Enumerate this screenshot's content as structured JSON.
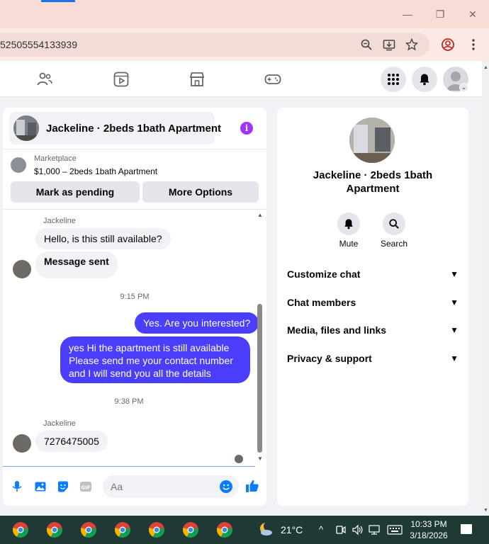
{
  "browser": {
    "url": "52505554133939",
    "window_controls": {
      "minimize": "—",
      "restore": "❐",
      "close": "✕"
    }
  },
  "fb_nav": {
    "icons": [
      "friends-icon",
      "watch-icon",
      "marketplace-icon",
      "gaming-icon"
    ],
    "menu_icon": "grid-icon",
    "notifications_icon": "bell-icon"
  },
  "chat": {
    "title": "Jackeline · 2beds 1bath Apartment",
    "marketplace": {
      "label": "Marketplace",
      "item": "$1,000 – 2beds 1bath Apartment"
    },
    "actions": {
      "mark_pending": "Mark as pending",
      "more_options": "More Options"
    },
    "messages": [
      {
        "sender": "Jackeline",
        "text": "Hello, is this still available?"
      },
      {
        "text": "Message sent"
      },
      {
        "time": "9:15 PM"
      },
      {
        "text": "Yes. Are you interested?"
      },
      {
        "lines": [
          "yes Hi the apartment is still available",
          "Please send me your contact number",
          "and I will send you all the details"
        ]
      },
      {
        "time": "9:38 PM"
      },
      {
        "sender": "Jackeline",
        "text": "7276475005"
      }
    ],
    "composer": {
      "placeholder": "Aa"
    }
  },
  "info_panel": {
    "title": "Jackeline · 2beds 1bath Apartment",
    "mute_label": "Mute",
    "search_label": "Search",
    "sections": [
      "Customize chat",
      "Chat members",
      "Media, files and links",
      "Privacy & support"
    ]
  },
  "taskbar": {
    "temperature": "21°C",
    "time": "10:33 PM",
    "date": "3/18/2026"
  },
  "colors": {
    "accent": "#0a7cff",
    "outgoing_bubble": "#4a3dfc",
    "info_button": "#a033ff"
  }
}
